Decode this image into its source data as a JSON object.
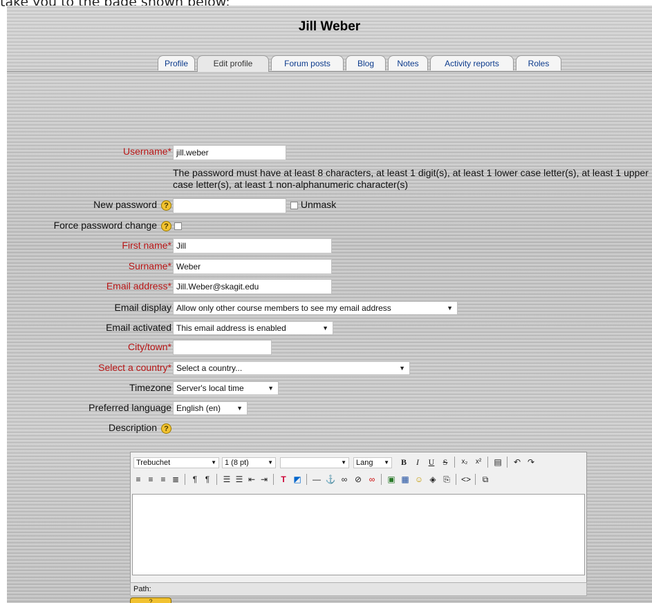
{
  "intro": {
    "text": "take you to the page shown below:"
  },
  "header": {
    "title": "Jill Weber"
  },
  "tabs": [
    {
      "label": "Profile"
    },
    {
      "label": "Edit profile"
    },
    {
      "label": "Forum posts"
    },
    {
      "label": "Blog"
    },
    {
      "label": "Notes"
    },
    {
      "label": "Activity reports"
    },
    {
      "label": "Roles"
    }
  ],
  "form": {
    "username": {
      "label": "Username",
      "required_mark": "*",
      "value": "jill.weber"
    },
    "password_note": "The password must have at least 8 characters, at least 1 digit(s), at least 1 lower case letter(s), at least 1 upper case letter(s), at least 1 non-alphanumeric character(s)",
    "new_password": {
      "label": "New password",
      "value": "",
      "unmask_label": "Unmask"
    },
    "force_password_change": {
      "label": "Force password change"
    },
    "first_name": {
      "label": "First name",
      "required_mark": "*",
      "value": "Jill"
    },
    "surname": {
      "label": "Surname",
      "required_mark": "*",
      "value": "Weber"
    },
    "email": {
      "label": "Email address",
      "required_mark": "*",
      "value": "Jill.Weber@skagit.edu"
    },
    "email_display": {
      "label": "Email display",
      "value": "Allow only other course members to see my email address"
    },
    "email_activated": {
      "label": "Email activated",
      "value": "This email address is enabled"
    },
    "city": {
      "label": "City/town",
      "required_mark": "*",
      "value": ""
    },
    "country": {
      "label": "Select a country",
      "required_mark": "*",
      "value": "Select a country..."
    },
    "timezone": {
      "label": "Timezone",
      "value": "Server's local time"
    },
    "language": {
      "label": "Preferred language",
      "value": "English (en)"
    },
    "description": {
      "label": "Description"
    }
  },
  "editor": {
    "font": "Trebuchet",
    "size": "1 (8 pt)",
    "style": "",
    "lang": "Lang",
    "path_label": "Path:"
  },
  "help_icon_glyph": "?",
  "colors": {
    "required": "#b81616",
    "link": "#0b3a8c",
    "help": "#f2c230"
  }
}
